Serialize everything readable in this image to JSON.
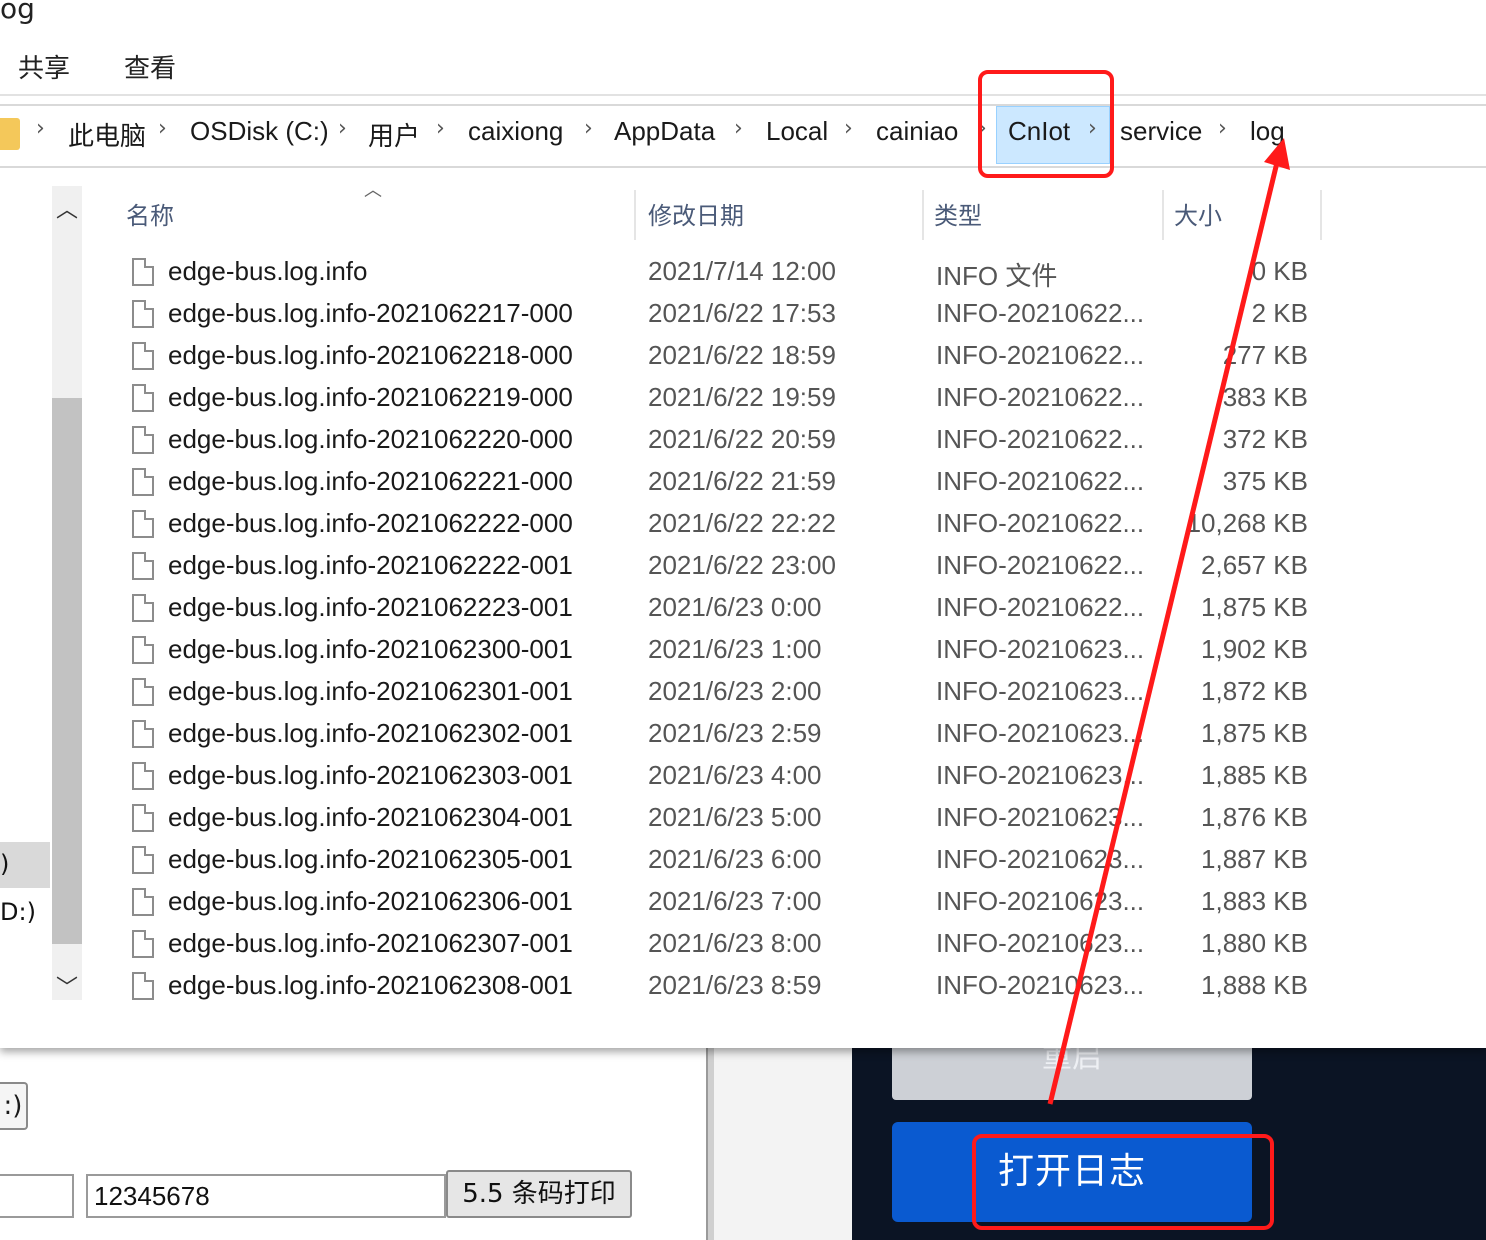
{
  "window": {
    "title_fragment": "og"
  },
  "menu": {
    "items": [
      "共享",
      "查看"
    ]
  },
  "address": {
    "crumbs": [
      "此电脑",
      "OSDisk (C:)",
      "用户",
      "caixiong",
      "AppData",
      "Local",
      "cainiao",
      "CnIot",
      "service",
      "log"
    ]
  },
  "nav": {
    "items": [
      ")",
      "D:)"
    ]
  },
  "columns": {
    "name": "名称",
    "date": "修改日期",
    "type": "类型",
    "size": "大小"
  },
  "files": [
    {
      "name": "edge-bus.log.info",
      "date": "2021/7/14 12:00",
      "type": "INFO 文件",
      "size": "0 KB"
    },
    {
      "name": "edge-bus.log.info-2021062217-000",
      "date": "2021/6/22 17:53",
      "type": "INFO-20210622...",
      "size": "2 KB"
    },
    {
      "name": "edge-bus.log.info-2021062218-000",
      "date": "2021/6/22 18:59",
      "type": "INFO-20210622...",
      "size": "277 KB"
    },
    {
      "name": "edge-bus.log.info-2021062219-000",
      "date": "2021/6/22 19:59",
      "type": "INFO-20210622...",
      "size": "383 KB"
    },
    {
      "name": "edge-bus.log.info-2021062220-000",
      "date": "2021/6/22 20:59",
      "type": "INFO-20210622...",
      "size": "372 KB"
    },
    {
      "name": "edge-bus.log.info-2021062221-000",
      "date": "2021/6/22 21:59",
      "type": "INFO-20210622...",
      "size": "375 KB"
    },
    {
      "name": "edge-bus.log.info-2021062222-000",
      "date": "2021/6/22 22:22",
      "type": "INFO-20210622...",
      "size": "10,268 KB"
    },
    {
      "name": "edge-bus.log.info-2021062222-001",
      "date": "2021/6/22 23:00",
      "type": "INFO-20210622...",
      "size": "2,657 KB"
    },
    {
      "name": "edge-bus.log.info-2021062223-001",
      "date": "2021/6/23 0:00",
      "type": "INFO-20210622...",
      "size": "1,875 KB"
    },
    {
      "name": "edge-bus.log.info-2021062300-001",
      "date": "2021/6/23 1:00",
      "type": "INFO-20210623...",
      "size": "1,902 KB"
    },
    {
      "name": "edge-bus.log.info-2021062301-001",
      "date": "2021/6/23 2:00",
      "type": "INFO-20210623...",
      "size": "1,872 KB"
    },
    {
      "name": "edge-bus.log.info-2021062302-001",
      "date": "2021/6/23 2:59",
      "type": "INFO-20210623...",
      "size": "1,875 KB"
    },
    {
      "name": "edge-bus.log.info-2021062303-001",
      "date": "2021/6/23 4:00",
      "type": "INFO-20210623...",
      "size": "1,885 KB"
    },
    {
      "name": "edge-bus.log.info-2021062304-001",
      "date": "2021/6/23 5:00",
      "type": "INFO-20210623...",
      "size": "1,876 KB"
    },
    {
      "name": "edge-bus.log.info-2021062305-001",
      "date": "2021/6/23 6:00",
      "type": "INFO-20210623...",
      "size": "1,887 KB"
    },
    {
      "name": "edge-bus.log.info-2021062306-001",
      "date": "2021/6/23 7:00",
      "type": "INFO-20210623...",
      "size": "1,883 KB"
    },
    {
      "name": "edge-bus.log.info-2021062307-001",
      "date": "2021/6/23 8:00",
      "type": "INFO-20210623...",
      "size": "1,880 KB"
    },
    {
      "name": "edge-bus.log.info-2021062308-001",
      "date": "2021/6/23 8:59",
      "type": "INFO-20210623...",
      "size": "1,888 KB"
    }
  ],
  "bg_app": {
    "small_button": ":)",
    "input_value": "12345678",
    "print_button": "5.5 条码打印",
    "restart_button": "重启",
    "open_log_button": "打开日志"
  },
  "annotation_color": "#ff1a1a",
  "accent_color": "#0a5ad0"
}
